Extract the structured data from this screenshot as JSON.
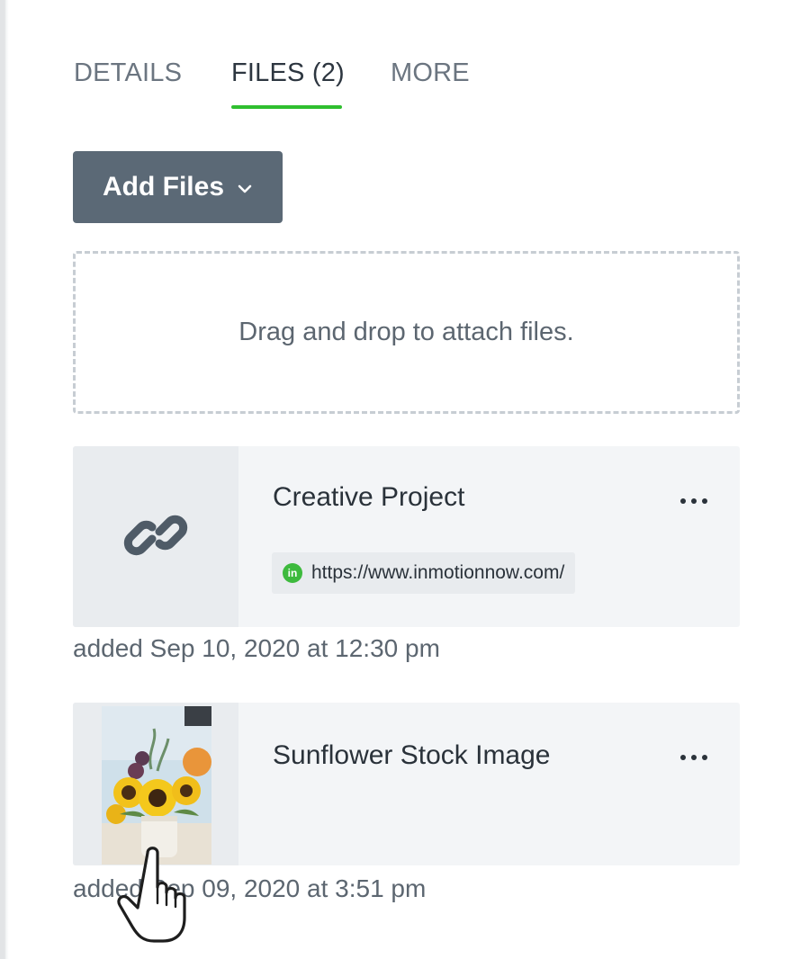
{
  "tabs": [
    {
      "label": "DETAILS",
      "active": false
    },
    {
      "label": "FILES (2)",
      "active": true
    },
    {
      "label": "MORE",
      "active": false
    }
  ],
  "accent_color": "#2fbf2f",
  "add_files": {
    "label": "Add Files",
    "icon": "chevron-down-icon"
  },
  "dropzone": {
    "text": "Drag and drop to attach files."
  },
  "files": [
    {
      "title": "Creative Project",
      "thumbnail_icon": "link-icon",
      "url": "https://www.inmotionnow.com/",
      "url_logo_text": "in",
      "added": "added Sep 10, 2020 at 12:30 pm",
      "menu_icon": "more-options-icon"
    },
    {
      "title": "Sunflower Stock Image",
      "thumbnail": "sunflower-photo",
      "added": "added Sep 09, 2020 at 3:51 pm",
      "menu_icon": "more-options-icon"
    }
  ],
  "cursor": "hand-pointer-cursor"
}
